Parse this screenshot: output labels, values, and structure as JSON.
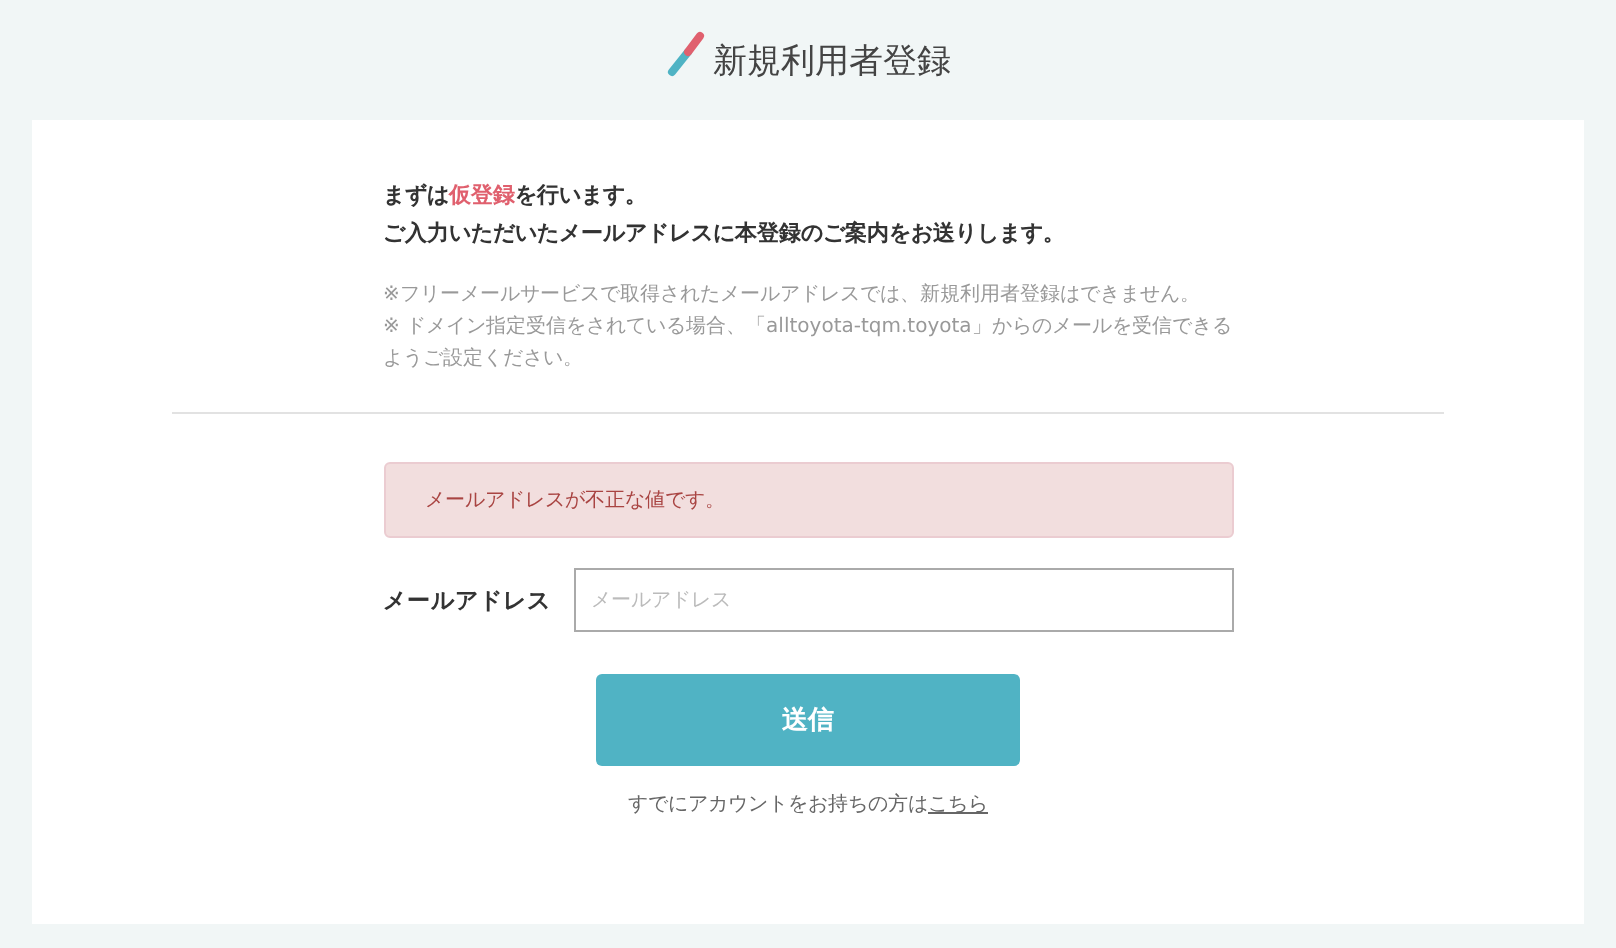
{
  "page_title": "新規利用者登録",
  "intro": [
    {
      "parts": [
        {
          "text": "まずは",
          "highlight": false
        },
        {
          "text": "仮登録",
          "highlight": true
        },
        {
          "text": "を行います。",
          "highlight": false
        }
      ]
    },
    {
      "parts": [
        {
          "text": "ご入力いただいたメールアドレスに本登録のご案内をお送りします。",
          "highlight": false
        }
      ]
    }
  ],
  "notes": [
    "※フリーメールサービスで取得されたメールアドレスでは、新規利用者登録はできません。",
    "※ ドメイン指定受信をされている場合、「alltoyota-tqm.toyota」からのメールを受信できるようご設定ください。"
  ],
  "error": "メールアドレスが不正な値です。",
  "email_field": {
    "label": "メールアドレス",
    "placeholder": "メールアドレス"
  },
  "submit_button": "送信",
  "login_prompt": {
    "text": "すでにアカウントをお持ちの方は",
    "link": "こちら"
  }
}
